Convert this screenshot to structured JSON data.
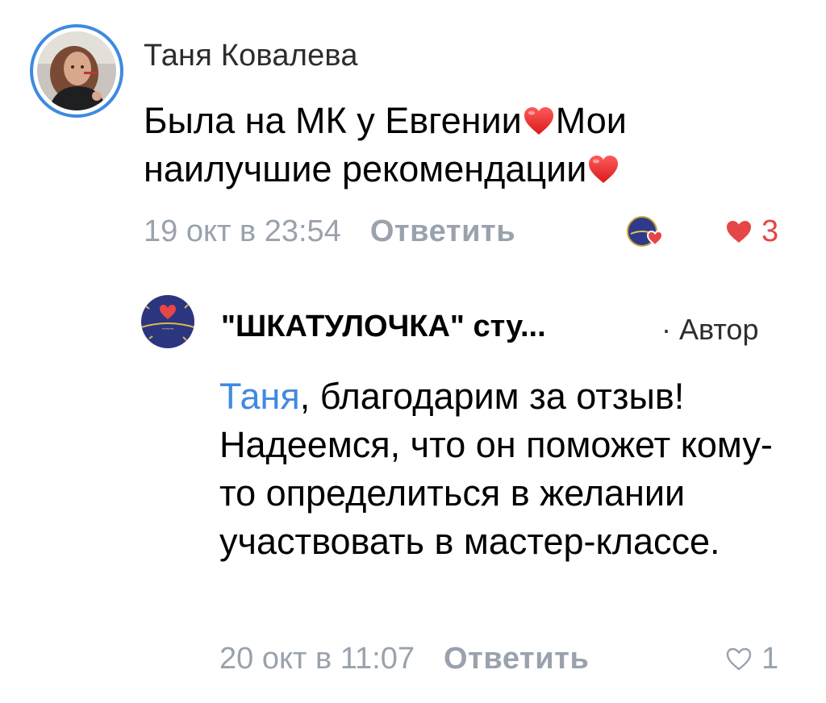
{
  "comment": {
    "author": "Таня Ковалева",
    "text_part1": "Была на МК у Евгении",
    "text_part2": "Мои наилучшие рекомендации",
    "timestamp": "19 окт в 23:54",
    "reply_label": "Ответить",
    "likes": "3",
    "liked": true,
    "emoji": "red-heart"
  },
  "reply": {
    "author": "\"ШКАТУЛОЧКА\" сту...",
    "author_tag": "· Автор",
    "mention": "Таня",
    "text": ", благодарим за отзыв! Надеемся, что он поможет кому-то определиться в желании участвовать в мастер-классе.",
    "timestamp": "20 окт в 11:07",
    "reply_label": "Ответить",
    "likes": "1",
    "liked": false
  },
  "colors": {
    "accent": "#3f8ae0",
    "muted": "#99a2ad",
    "like_red": "#e64646"
  }
}
